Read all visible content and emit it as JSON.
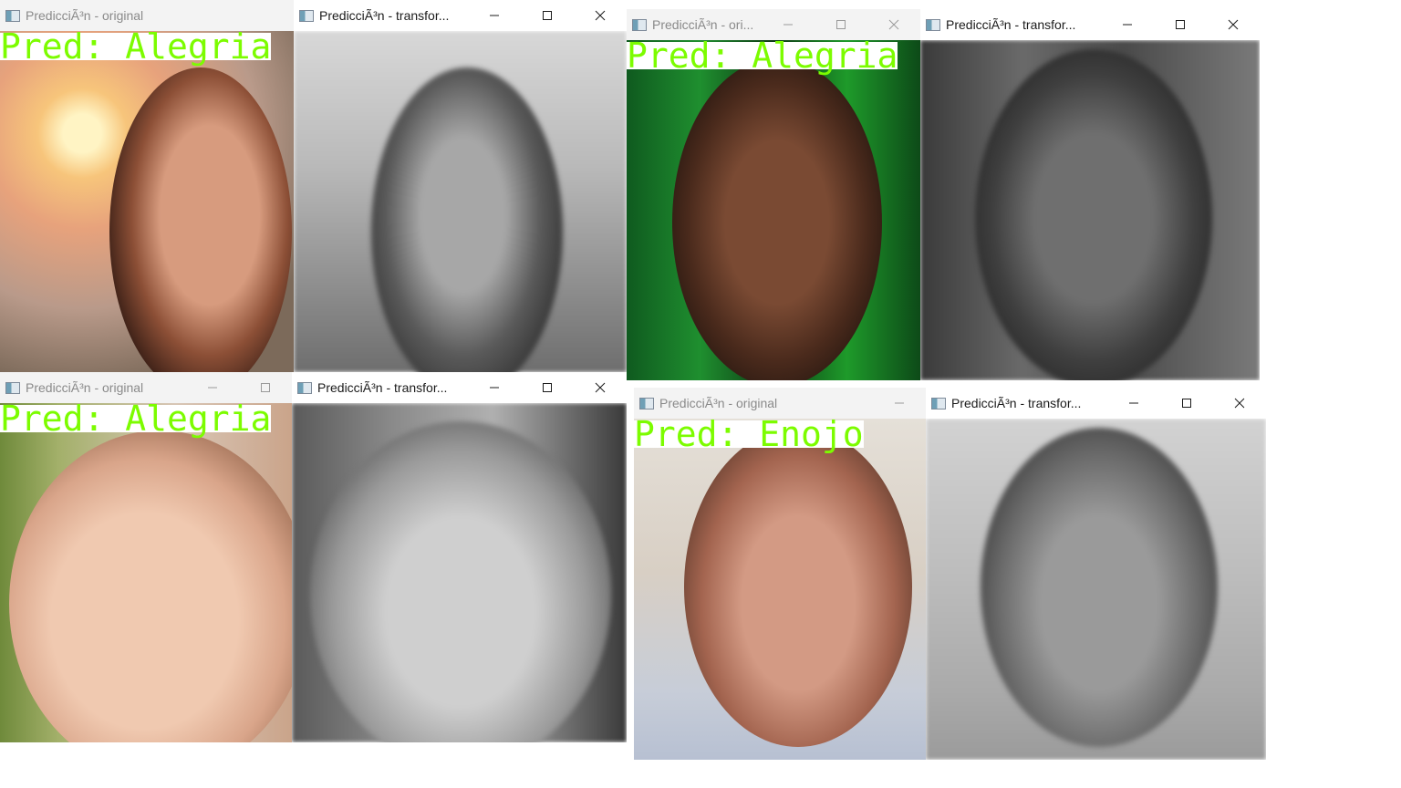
{
  "windows": [
    {
      "title": "PredicciÃ³n - original",
      "prediction": "Pred: Alegria"
    },
    {
      "title": "PredicciÃ³n - transfor..."
    },
    {
      "title": "PredicciÃ³n - ori..."
    },
    {
      "title": "PredicciÃ³n - transfor..."
    },
    {
      "title": "PredicciÃ³n - original",
      "prediction": "Pred: Alegria"
    },
    {
      "title": "PredicciÃ³n - transfor..."
    },
    {
      "title": "PredicciÃ³n - original",
      "prediction": "Pred: Enojo"
    },
    {
      "title": "PredicciÃ³n - transfor..."
    }
  ],
  "window3_prediction": "Pred: Alegria",
  "controls": {
    "minimize": "─",
    "maximize": "☐",
    "close": "✕"
  },
  "colors": {
    "prediction_text": "#7cfc00",
    "label_bg": "#ffffff"
  }
}
